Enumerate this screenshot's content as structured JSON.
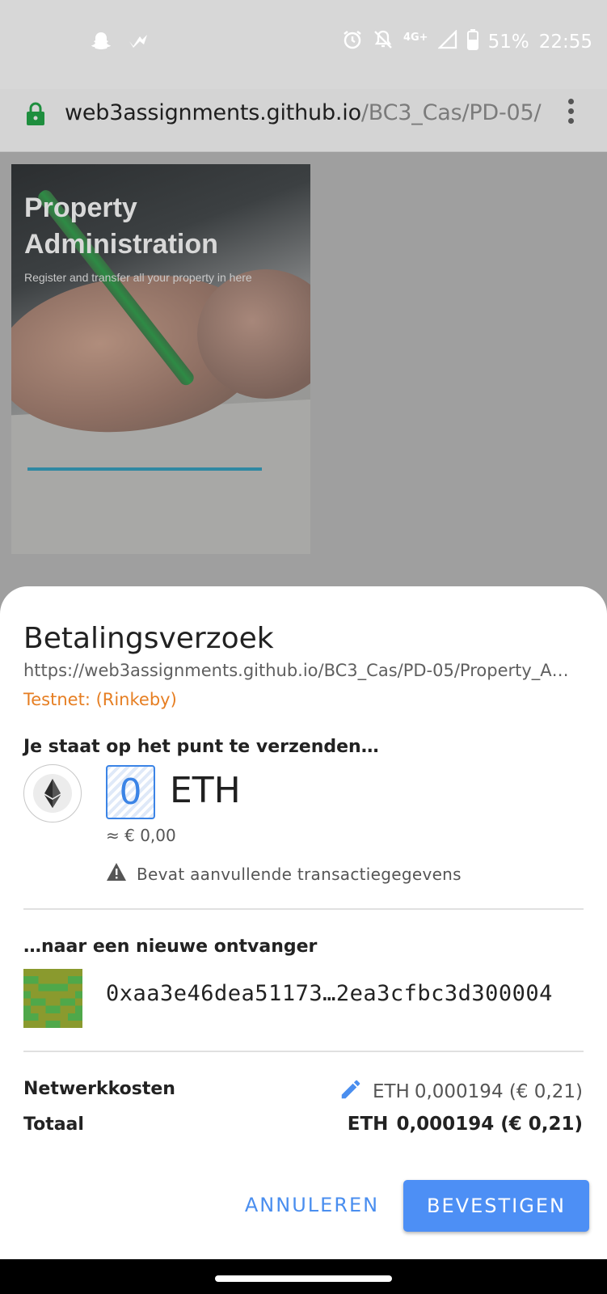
{
  "status_bar": {
    "battery": "51%",
    "time": "22:55",
    "network": "4G+",
    "icons": [
      "snapchat-icon",
      "check-icon",
      "alarm-icon",
      "notifications-off-icon",
      "signal-icon",
      "battery-icon"
    ]
  },
  "browser": {
    "url_domain": "web3assignments.github.io",
    "url_path": "/BC3_Cas/PD-05/",
    "icons": [
      "lock-icon",
      "more-vert-icon"
    ]
  },
  "page": {
    "hero_title": "Property Administration",
    "hero_subtitle": "Register and transfer all your property in here"
  },
  "payment_sheet": {
    "title": "Betalingsverzoek",
    "url": "https://web3assignments.github.io/BC3_Cas/PD-05/Property_A…",
    "network": "Testnet: (Rinkeby)",
    "send_heading": "Je staat op het punt te verzenden…",
    "amount": "0",
    "amount_unit": "ETH",
    "fiat_estimate": "≈ € 0,00",
    "warning": "Bevat aanvullende transactiegegevens",
    "recipient_heading": "…naar een nieuwe ontvanger",
    "recipient_address": "0xaa3e46dea51173…2ea3cfbc3d300004",
    "fee_label": "Netwerkkosten",
    "fee_currency": "ETH",
    "fee_value": "0,000194 (€ 0,21)",
    "total_label": "Totaal",
    "total_currency": "ETH",
    "total_value": "0,000194 (€ 0,21)",
    "cancel_label": "ANNULEREN",
    "confirm_label": "BEVESTIGEN",
    "accent_color": "#4d8ff5",
    "network_color": "#e67e22"
  }
}
